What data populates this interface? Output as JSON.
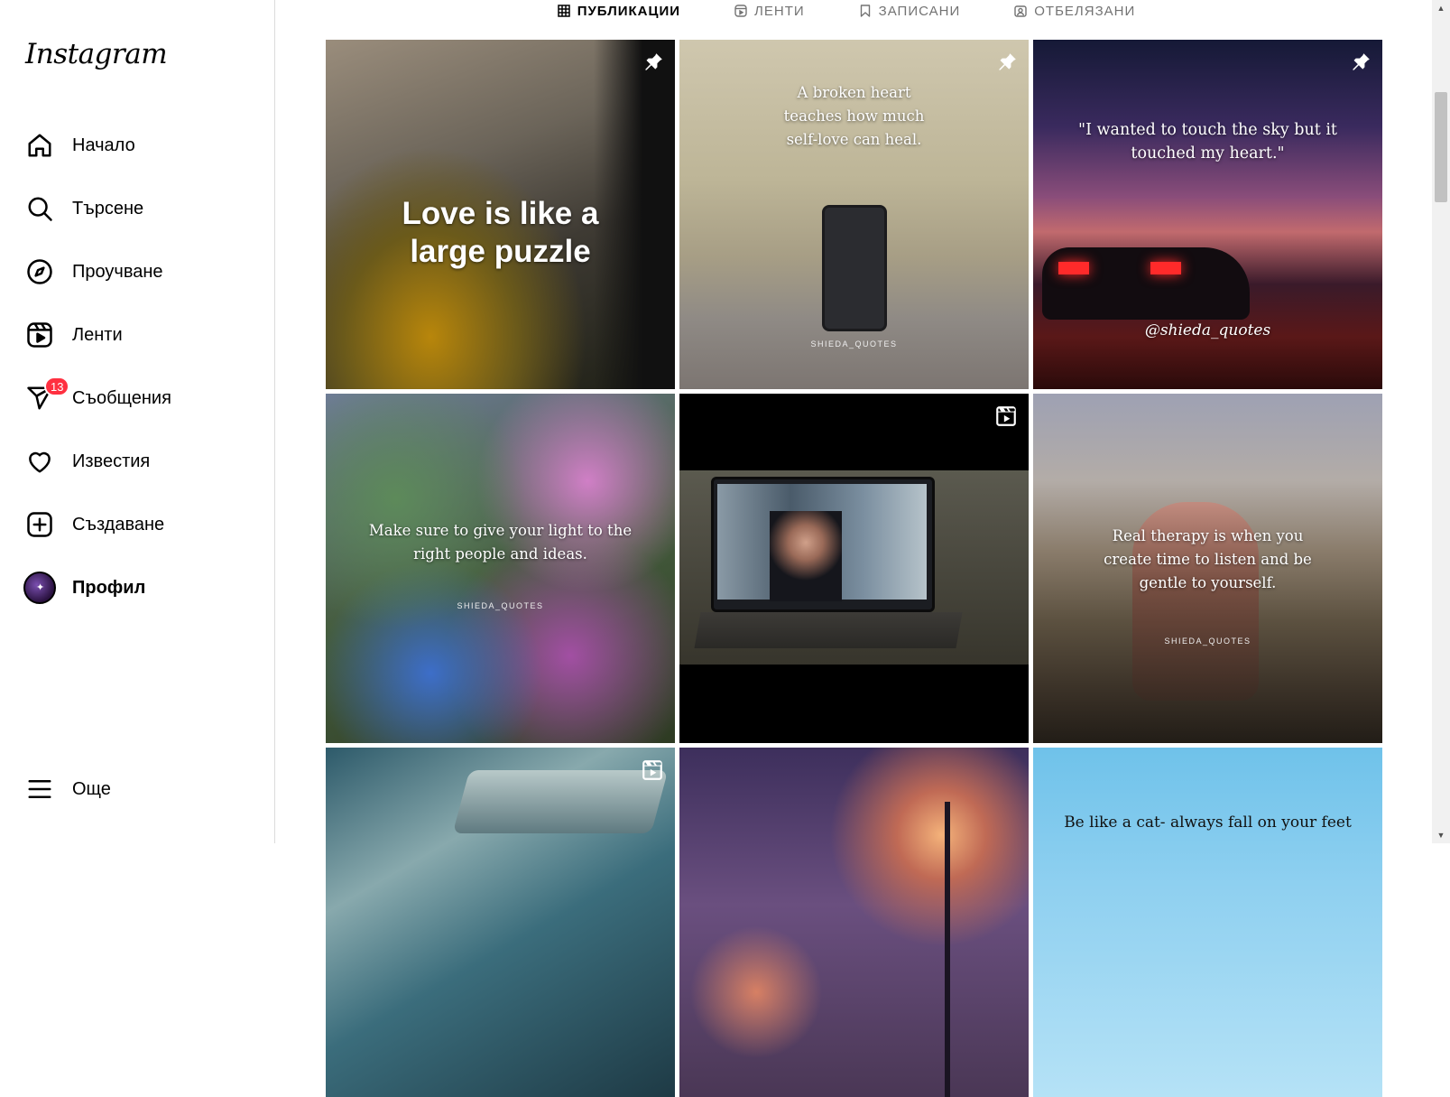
{
  "app": {
    "logo": "Instagram"
  },
  "nav": {
    "home": "Начало",
    "search": "Търсене",
    "explore": "Проучване",
    "reels": "Ленти",
    "messages": "Съобщения",
    "messages_badge": "13",
    "notifications": "Известия",
    "create": "Създаване",
    "profile": "Профил",
    "more": "Още"
  },
  "tabs": {
    "posts": "ПУБЛИКАЦИИ",
    "reels": "ЛЕНТИ",
    "saved": "ЗАПИСАНИ",
    "tagged": "ОТБЕЛЯЗАНИ"
  },
  "posts": [
    {
      "caption": "Love is like a large puzzle",
      "marker": "pin-icon"
    },
    {
      "caption": "A broken heart teaches how much self-love can heal.",
      "watermark": "SHIEDA_QUOTES",
      "marker": "pin-icon"
    },
    {
      "caption": "\"I wanted to touch the sky but it touched my heart.\"",
      "signature": "@shieda_quotes",
      "marker": "pin-icon"
    },
    {
      "caption": "Make sure to give your light to the right people and ideas.",
      "watermark": "SHIEDA_QUOTES"
    },
    {
      "caption": "",
      "marker": "reel-icon"
    },
    {
      "caption": "Real therapy is when you create time to listen and be gentle to yourself.",
      "watermark": "SHIEDA_QUOTES"
    },
    {
      "caption": "",
      "marker": "reel-icon"
    },
    {
      "caption": ""
    },
    {
      "caption": "Be like a cat- always fall on your feet"
    }
  ],
  "colors": {
    "badge": "#ff3040",
    "tab_inactive": "#737373",
    "border": "#dbdbdb"
  }
}
